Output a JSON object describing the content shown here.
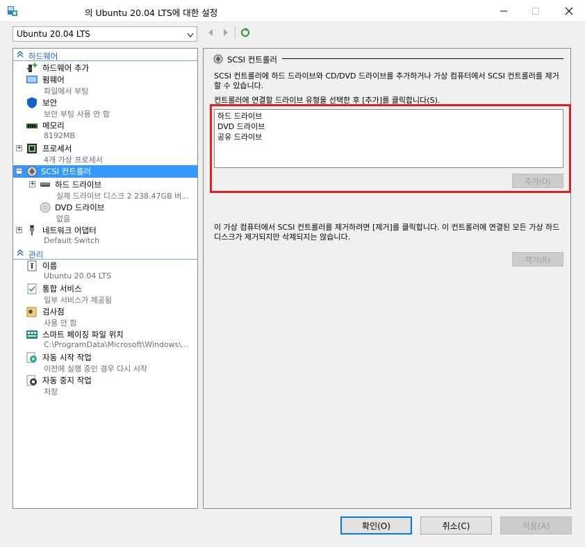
{
  "window": {
    "title": "의 Ubuntu 20.04 LTS에 대한 설정"
  },
  "vm_selector": {
    "selected": "Ubuntu 20.04 LTS"
  },
  "tree": {
    "hardware_header": "하드웨어",
    "management_header": "관리",
    "hardware_items": [
      {
        "label": "하드웨어 추가",
        "sub": ""
      },
      {
        "label": "펌웨어",
        "sub": "파일에서 부팅"
      },
      {
        "label": "보안",
        "sub": "보안 부팅 사용 안 함"
      },
      {
        "label": "메모리",
        "sub": "8192MB"
      },
      {
        "label": "프로세서",
        "sub": "4개 가상 프로세서"
      },
      {
        "label": "SCSI 컨트롤러",
        "sub": ""
      },
      {
        "label": "하드 드라이브",
        "sub": "실제 드라이브 디스크 2 238.47GB 버..."
      },
      {
        "label": "DVD 드라이브",
        "sub": "없음"
      },
      {
        "label": "네트워크 어댑터",
        "sub": "Default Switch"
      }
    ],
    "management_items": [
      {
        "label": "이름",
        "sub": "Ubuntu 20.04 LTS"
      },
      {
        "label": "통합 서비스",
        "sub": "일부 서비스가 제공됨"
      },
      {
        "label": "검사점",
        "sub": "사용 안 함"
      },
      {
        "label": "스마트 페이징 파일 위치",
        "sub": "C:\\ProgramData\\Microsoft\\Windows\\..."
      },
      {
        "label": "자동 시작 작업",
        "sub": "이전에 실행 중인 경우 다시 시작"
      },
      {
        "label": "자동 중지 작업",
        "sub": "저장"
      }
    ]
  },
  "panel": {
    "title": "SCSI 컨트롤러",
    "description": "SCSI 컨트롤러에 하드 드라이브와 CD/DVD 드라이브를 추가하거나 가상 컴퓨터에서 SCSI 컨트롤러를 제거할 수 있습니다.",
    "instruction": "컨트롤러에 연결할 드라이브 유형을 선택한 후 [추가]를 클릭합니다(S).",
    "drive_types": [
      "하드 드라이브",
      "DVD 드라이브",
      "공유 드라이브"
    ],
    "add_label": "추가(D)",
    "remove_description": "이 가상 컴퓨터에서 SCSI 컨트롤러를 제거하려면 [제거]를 클릭합니다. 이 컨트롤러에 연결된 모든 가상 하드 디스크가 제거되지만 삭제되지는 않습니다.",
    "remove_label": "제거(R)"
  },
  "footer": {
    "ok_label": "확인(O)",
    "cancel_label": "취소(C)",
    "apply_label": "적용(A)"
  },
  "colors": {
    "selection": "#3399ff",
    "section_header": "#1f63c0",
    "highlight_border": "#e02020"
  }
}
